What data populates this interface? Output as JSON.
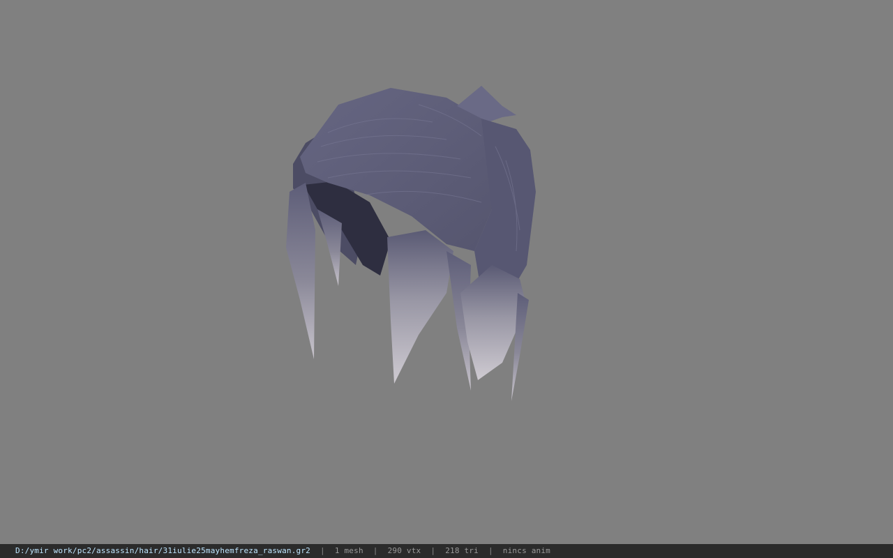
{
  "statusbar": {
    "file_path": "D:/ymir work/pc2/assassin/hair/31iulie25mayhemfreza_raswan.gr2",
    "mesh_count": "1 mesh",
    "vertex_count": "290 vtx",
    "triangle_count": "218 tri",
    "animation": "nincs anim",
    "separator": "|"
  },
  "viewport": {
    "background_color": "#808080",
    "model_base_color": "#5d5d78",
    "model_tip_color": "#c8c4cc",
    "model_shadow_color": "#2e2e40"
  }
}
